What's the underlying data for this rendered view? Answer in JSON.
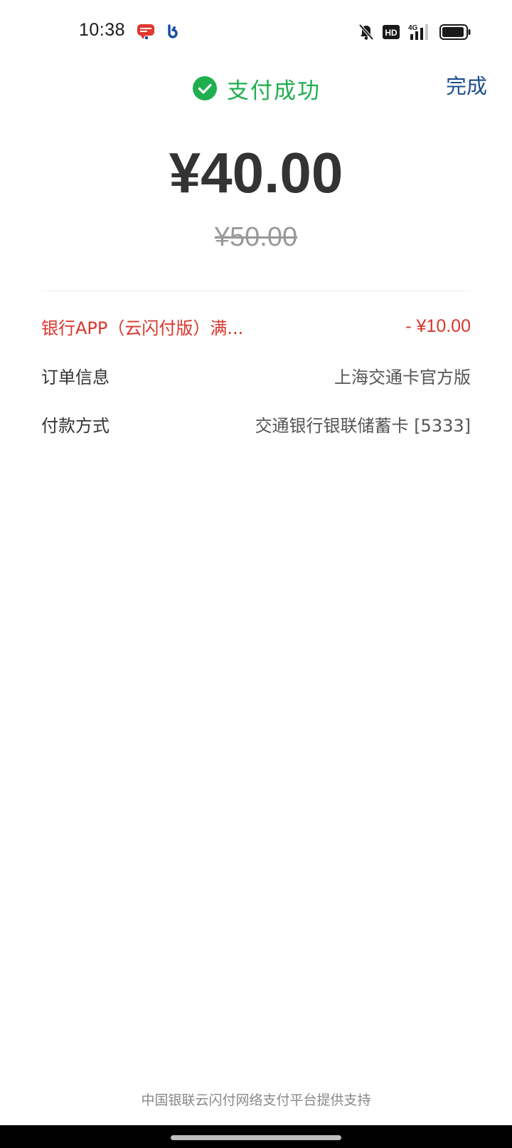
{
  "status_bar": {
    "time": "10:38",
    "network": "4G",
    "hd_badge": "HD",
    "icons": [
      "cloud-quickpass-app-icon",
      "bankcomm-app-icon",
      "mute-bell-icon",
      "hd-icon",
      "signal-4g-icon",
      "battery-icon"
    ]
  },
  "header": {
    "title": "支付成功",
    "done_label": "完成",
    "success_color": "#1faf4f",
    "done_color": "#1b4e8c"
  },
  "payment": {
    "amount": "¥40.00",
    "original_amount": "¥50.00"
  },
  "details": {
    "discount": {
      "label": "银行APP（云闪付版）满...",
      "value": "- ¥10.00",
      "color": "#d9362c"
    },
    "order": {
      "label": "订单信息",
      "value": "上海交通卡官方版"
    },
    "method": {
      "label": "付款方式",
      "value": "交通银行银联储蓄卡 [5333]"
    }
  },
  "footer": {
    "text": "中国银联云闪付网络支付平台提供支持"
  }
}
